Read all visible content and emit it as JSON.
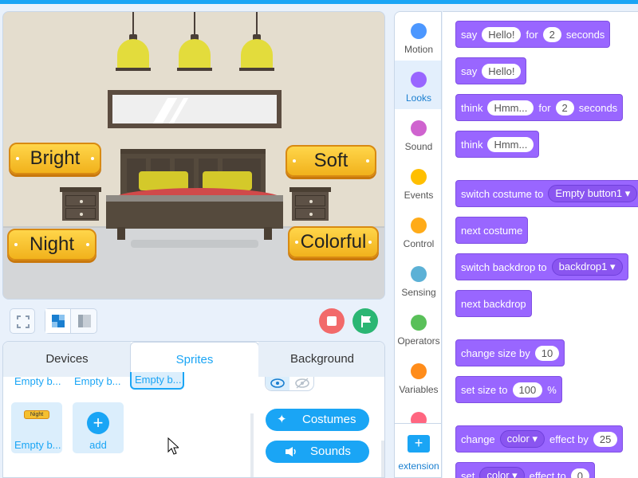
{
  "stage": {
    "buttons": [
      "Bright",
      "Soft",
      "Night",
      "Colorful"
    ]
  },
  "bottom": {
    "tabs": [
      "Devices",
      "Sprites",
      "Background"
    ],
    "sprite_labels": [
      "Empty b...",
      "Empty b...",
      "Empty b...",
      "Empty b..."
    ],
    "thumb_text": "Night",
    "add_label": "add",
    "costumes_label": "Costumes",
    "sounds_label": "Sounds"
  },
  "categories": [
    {
      "label": "Motion",
      "color": "#4c97ff"
    },
    {
      "label": "Looks",
      "color": "#9966ff"
    },
    {
      "label": "Sound",
      "color": "#cf63cf"
    },
    {
      "label": "Events",
      "color": "#ffbf00"
    },
    {
      "label": "Control",
      "color": "#ffab19"
    },
    {
      "label": "Sensing",
      "color": "#5cb1d6"
    },
    {
      "label": "Operators",
      "color": "#59c059"
    },
    {
      "label": "Variables",
      "color": "#ff8c1a"
    }
  ],
  "extension_label": "extension",
  "blocks": {
    "say_for": {
      "w1": "say",
      "v1": "Hello!",
      "w2": "for",
      "v2": "2",
      "w3": "seconds"
    },
    "say": {
      "w1": "say",
      "v1": "Hello!"
    },
    "think_for": {
      "w1": "think",
      "v1": "Hmm...",
      "w2": "for",
      "v2": "2",
      "w3": "seconds"
    },
    "think": {
      "w1": "think",
      "v1": "Hmm..."
    },
    "switch_costume": {
      "w1": "switch costume to",
      "v1": "Empty button1 ▾"
    },
    "next_costume": {
      "w1": "next costume"
    },
    "switch_backdrop": {
      "w1": "switch backdrop to",
      "v1": "backdrop1 ▾"
    },
    "next_backdrop": {
      "w1": "next backdrop"
    },
    "change_size": {
      "w1": "change size by",
      "v1": "10"
    },
    "set_size": {
      "w1": "set size to",
      "v1": "100",
      "w2": "%"
    },
    "change_effect": {
      "w1": "change",
      "v1": "color ▾",
      "w2": "effect by",
      "v2": "25"
    },
    "set_effect": {
      "w1": "set",
      "v1": "color ▾",
      "w2": "effect to",
      "v2": "0"
    }
  },
  "colors": {
    "accent": "#1aa5f5",
    "looks": "#9966ff",
    "stop": "#f05a5a",
    "go": "#2bb673"
  }
}
